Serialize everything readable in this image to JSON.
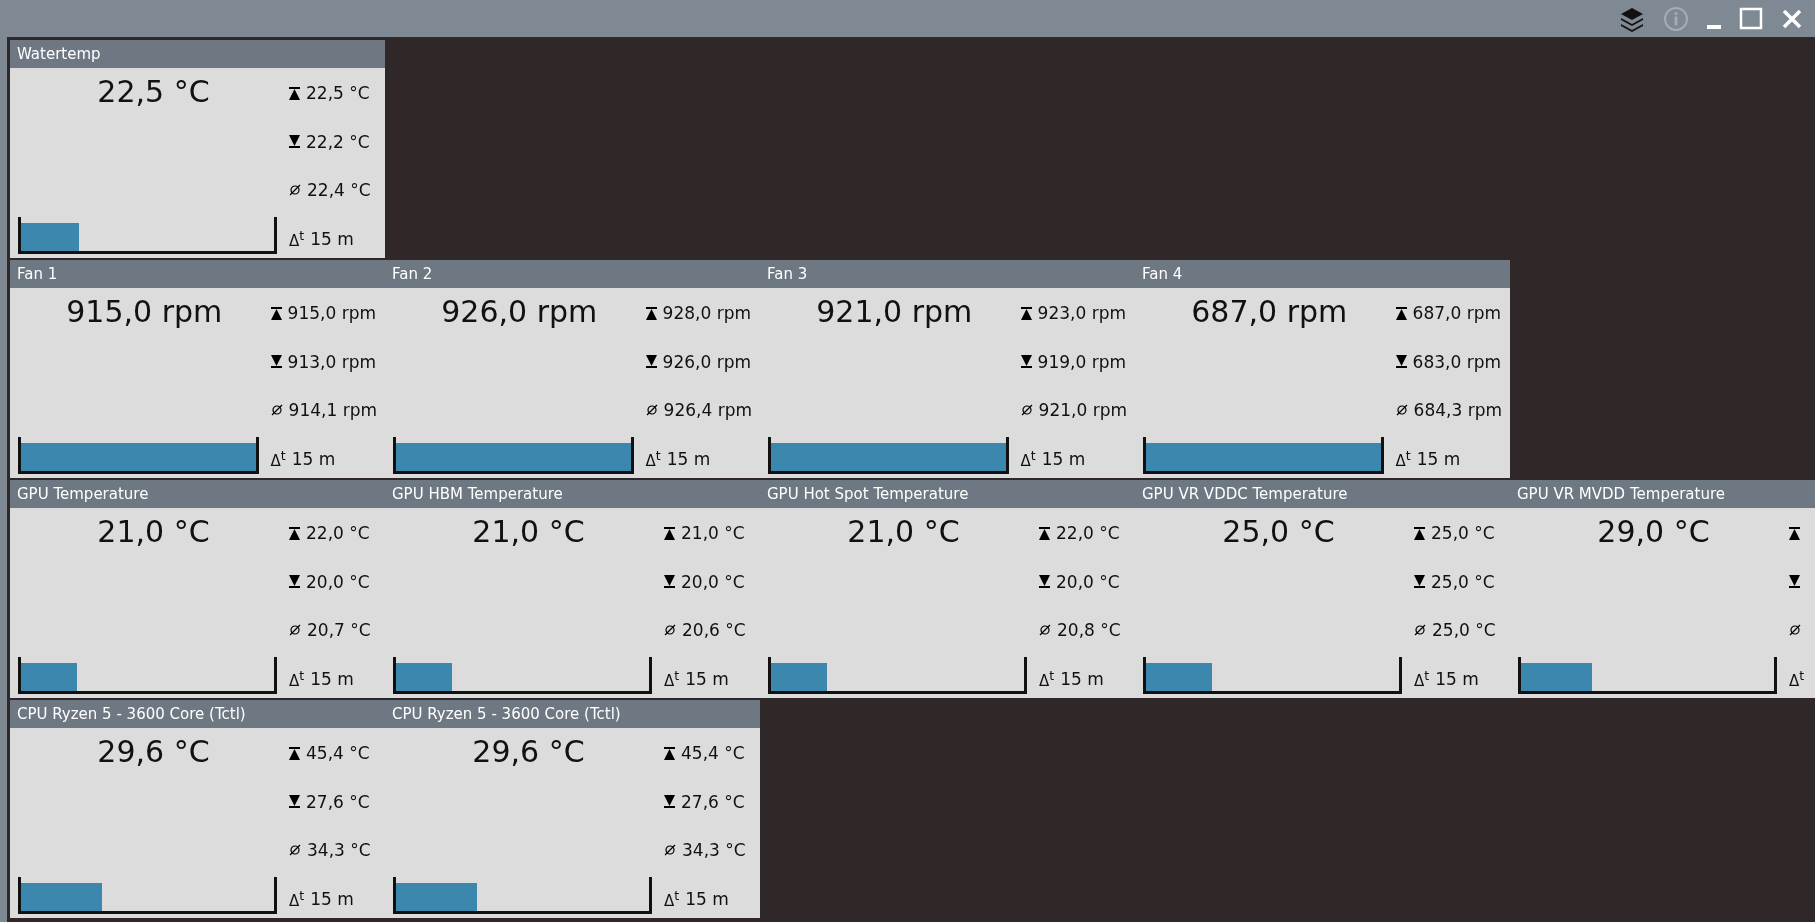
{
  "title_bar": {
    "buttons": [
      {
        "kind": "layers",
        "disabled": false
      },
      {
        "kind": "info",
        "disabled": true
      },
      {
        "kind": "minimize",
        "disabled": false
      },
      {
        "kind": "maximize",
        "disabled": false
      },
      {
        "kind": "close",
        "disabled": false
      }
    ]
  },
  "rows": [
    {
      "cards": [
        {
          "title": "Watertemp",
          "value": "22,5 °C",
          "level": 0.23,
          "stats": [
            {
              "kind": "max",
              "text": "22,5 °C"
            },
            {
              "kind": "min",
              "text": "22,2 °C"
            },
            {
              "kind": "avg",
              "text": "22,4 °C"
            },
            {
              "kind": "span",
              "label": "Δ$^{t}$",
              "text": "15 m"
            }
          ]
        }
      ]
    },
    {
      "cards": [
        {
          "title": "Fan 1",
          "value": "915,0 rpm",
          "level": 1,
          "stats": [
            {
              "kind": "max",
              "text": "915,0 rpm"
            },
            {
              "kind": "min",
              "text": "913,0 rpm"
            },
            {
              "kind": "avg",
              "text": "914,1 rpm"
            },
            {
              "kind": "span",
              "label": "Δ$^{t}$",
              "text": "15 m"
            }
          ]
        },
        {
          "title": "Fan 2",
          "value": "926,0 rpm",
          "level": 1,
          "stats": [
            {
              "kind": "max",
              "text": "928,0 rpm"
            },
            {
              "kind": "min",
              "text": "926,0 rpm"
            },
            {
              "kind": "avg",
              "text": "926,4 rpm"
            },
            {
              "kind": "span",
              "label": "Δ$^{t}$",
              "text": "15 m"
            }
          ]
        },
        {
          "title": "Fan 3",
          "value": "921,0 rpm",
          "level": 1,
          "stats": [
            {
              "kind": "max",
              "text": "923,0 rpm"
            },
            {
              "kind": "min",
              "text": "919,0 rpm"
            },
            {
              "kind": "avg",
              "text": "921,0 rpm"
            },
            {
              "kind": "span",
              "label": "Δ$^{t}$",
              "text": "15 m"
            }
          ]
        },
        {
          "title": "Fan 4",
          "value": "687,0 rpm",
          "level": 1,
          "stats": [
            {
              "kind": "max",
              "text": "687,0 rpm"
            },
            {
              "kind": "min",
              "text": "683,0 rpm"
            },
            {
              "kind": "avg",
              "text": "684,3 rpm"
            },
            {
              "kind": "span",
              "label": "Δ$^{t}$",
              "text": "15 m"
            }
          ]
        }
      ]
    },
    {
      "cards": [
        {
          "title": "GPU Temperature",
          "value": "21,0 °C",
          "level": 0.22,
          "stats": [
            {
              "kind": "max",
              "text": "22,0 °C"
            },
            {
              "kind": "min",
              "text": "20,0 °C"
            },
            {
              "kind": "avg",
              "text": "20,7 °C"
            },
            {
              "kind": "span",
              "label": "Δ$^{t}$",
              "text": "15 m"
            }
          ]
        },
        {
          "title": "GPU HBM Temperature",
          "value": "21,0 °C",
          "level": 0.22,
          "stats": [
            {
              "kind": "max",
              "text": "21,0 °C"
            },
            {
              "kind": "min",
              "text": "20,0 °C"
            },
            {
              "kind": "avg",
              "text": "20,6 °C"
            },
            {
              "kind": "span",
              "label": "Δ$^{t}$",
              "text": "15 m"
            }
          ]
        },
        {
          "title": "GPU Hot Spot Temperature",
          "value": "21,0 °C",
          "level": 0.22,
          "stats": [
            {
              "kind": "max",
              "text": "22,0 °C"
            },
            {
              "kind": "min",
              "text": "20,0 °C"
            },
            {
              "kind": "avg",
              "text": "20,8 °C"
            },
            {
              "kind": "span",
              "label": "Δ$^{t}$",
              "text": "15 m"
            }
          ]
        },
        {
          "title": "GPU VR VDDC Temperature",
          "value": "25,0 °C",
          "level": 0.26,
          "stats": [
            {
              "kind": "max",
              "text": "25,0 °C"
            },
            {
              "kind": "min",
              "text": "25,0 °C"
            },
            {
              "kind": "avg",
              "text": "25,0 °C"
            },
            {
              "kind": "span",
              "label": "Δ$^{t}$",
              "text": "15 m"
            }
          ]
        },
        {
          "title": "GPU VR MVDD Temperature",
          "value": "29,0 °C",
          "level": 0.28,
          "stats": [
            {
              "kind": "max"
            },
            {
              "kind": "min"
            },
            {
              "kind": "avg"
            },
            {
              "kind": "span",
              "label": "Δ$^{t}$"
            }
          ]
        }
      ]
    },
    {
      "cards": [
        {
          "title": "CPU Ryzen 5 - 3600 Core (Tctl)",
          "value": "29,6 °C",
          "level": 0.32,
          "stats": [
            {
              "kind": "max",
              "text": "45,4 °C"
            },
            {
              "kind": "min",
              "text": "27,6 °C"
            },
            {
              "kind": "avg",
              "text": "34,3 °C"
            },
            {
              "kind": "span",
              "label": "Δ$^{t}$",
              "text": "15 m"
            }
          ]
        },
        {
          "title": "CPU Ryzen 5 - 3600 Core (Tctl)",
          "value": "29,6 °C",
          "level": 0.32,
          "stats": [
            {
              "kind": "max",
              "text": "45,4 °C"
            },
            {
              "kind": "min",
              "text": "27,6 °C"
            },
            {
              "kind": "avg",
              "text": "34,3 °C"
            },
            {
              "kind": "span",
              "label": "Δ$^{t}$",
              "text": "15 m"
            }
          ]
        }
      ]
    }
  ]
}
